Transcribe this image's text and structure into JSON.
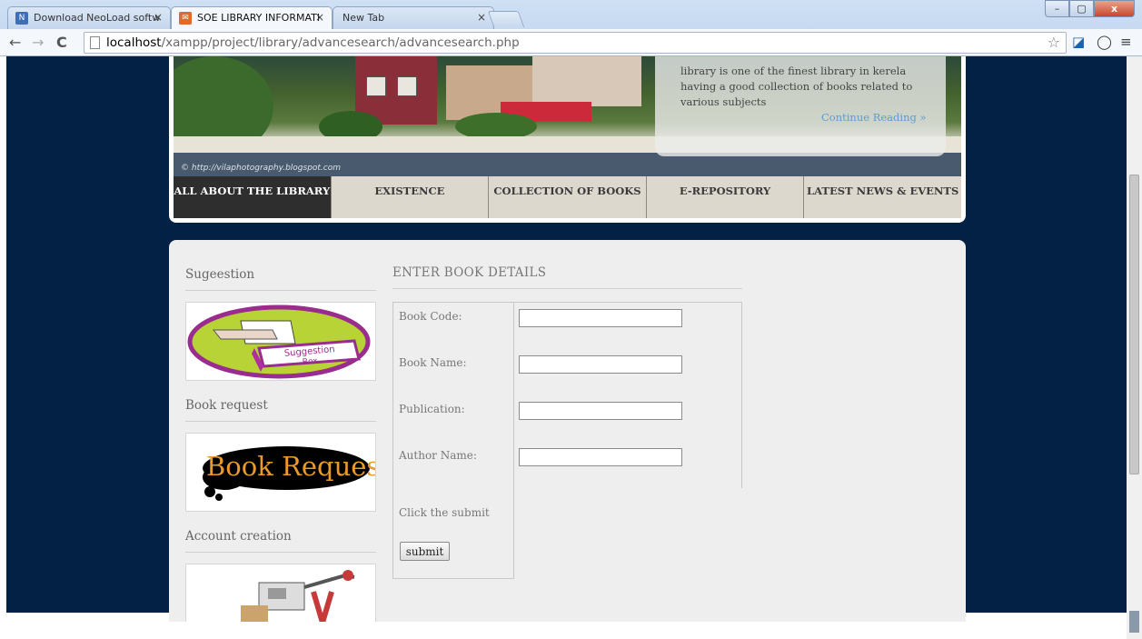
{
  "browser": {
    "tabs": [
      {
        "title": "Download NeoLoad softw",
        "close": "×",
        "favicon_color": "#3c6fb5"
      },
      {
        "title": "SOE LIBRARY INFORMATI",
        "close": "×",
        "favicon_color": "#e06a2b"
      },
      {
        "title": "New Tab",
        "close": "×"
      }
    ],
    "url_host": "localhost",
    "url_path": "/xampp/project/library/advancesearch/advancesearch.php",
    "window_buttons": {
      "minimize": "–",
      "maximize": "▢",
      "close": "x"
    }
  },
  "banner": {
    "watermark": "© http://vilaphotography.blogspot.com",
    "intro_text": "library is one of the finest library in kerela having a good collection of books related to various subjects",
    "continue_label": "Continue Reading »"
  },
  "nav": {
    "items": [
      "ALL ABOUT THE LIBRARY",
      "EXISTENCE",
      "COLLECTION OF BOOKS",
      "E-REPOSITORY",
      "LATEST NEWS & EVENTS"
    ]
  },
  "sidebar": {
    "suggestion_heading": "Sugeestion",
    "suggestion_image_text": [
      "Suggestion",
      "Box"
    ],
    "book_request_heading": "Book request",
    "book_request_image_text": "Book Request",
    "account_heading": "Account creation"
  },
  "form": {
    "title": "ENTER BOOK DETAILS",
    "fields": [
      {
        "label": "Book Code:",
        "value": ""
      },
      {
        "label": "Book Name:",
        "value": ""
      },
      {
        "label": "Publication:",
        "value": ""
      },
      {
        "label": "Author Name:",
        "value": ""
      }
    ],
    "hint": "Click the submit",
    "submit_label": "submit"
  },
  "colors": {
    "page_bg": "#032144",
    "link": "#5a9cd4",
    "nav_active": "#2e2e2e"
  }
}
